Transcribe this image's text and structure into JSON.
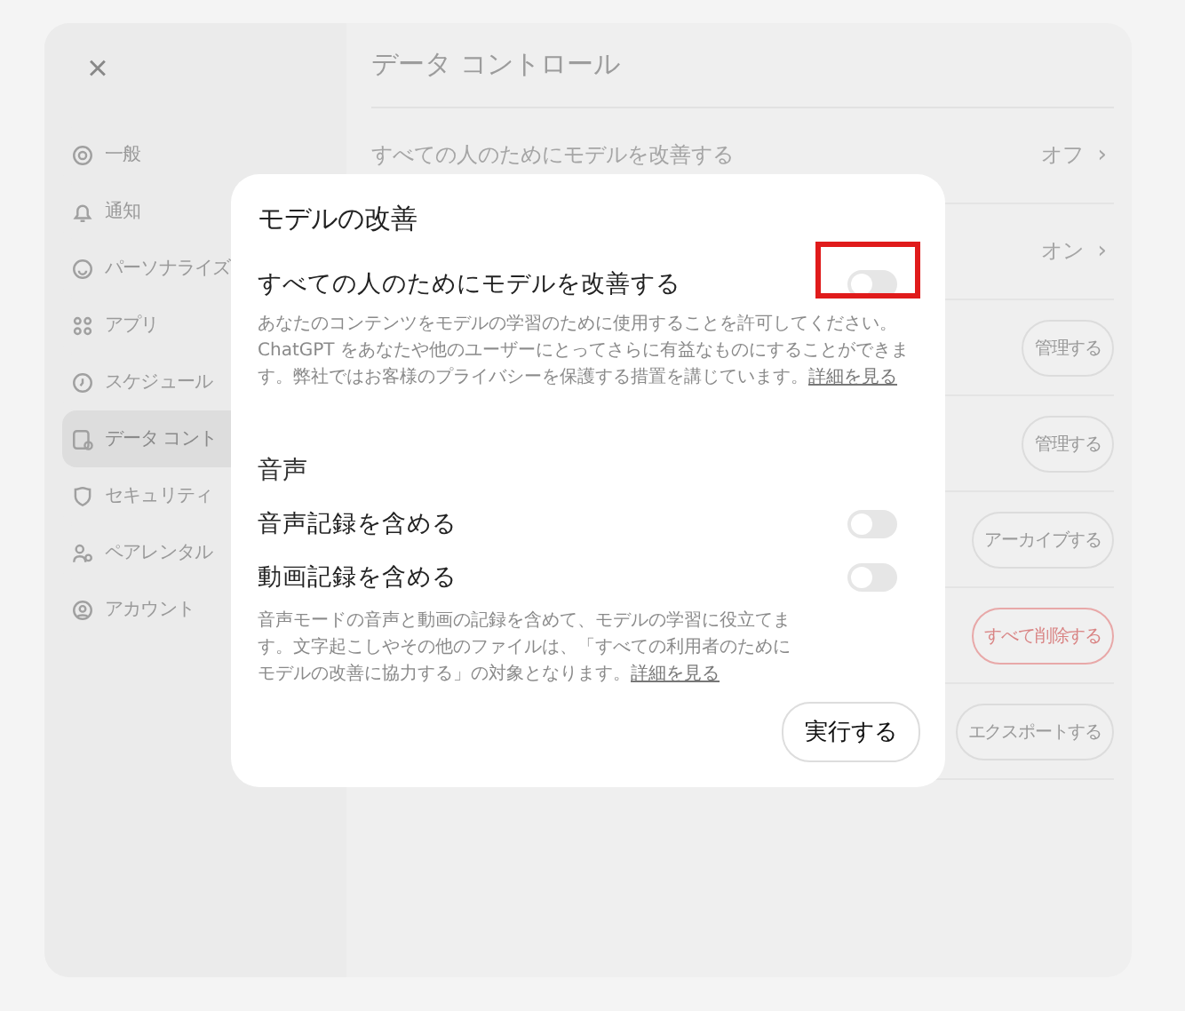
{
  "sidebar": {
    "close": "×",
    "items": [
      {
        "label": "一般",
        "selected": false
      },
      {
        "label": "通知",
        "selected": false
      },
      {
        "label": "パーソナライズ",
        "selected": false
      },
      {
        "label": "アプリ",
        "selected": false
      },
      {
        "label": "スケジュール",
        "selected": false
      },
      {
        "label": "データ コント",
        "selected": true
      },
      {
        "label": "セキュリティ",
        "selected": false
      },
      {
        "label": "ペアレンタル",
        "selected": false
      },
      {
        "label": "アカウント",
        "selected": false
      }
    ]
  },
  "panel": {
    "title": "データ コントロール",
    "rows": [
      {
        "kind": "value",
        "label": "すべての人のためにモデルを改善する",
        "value": "オフ",
        "chevron": "›"
      },
      {
        "kind": "value",
        "value": "オン",
        "chevron": "›"
      },
      {
        "kind": "button",
        "action": "管理する",
        "danger": false
      },
      {
        "kind": "button",
        "action": "管理する",
        "danger": false
      },
      {
        "kind": "button",
        "action": "アーカイブする",
        "danger": false
      },
      {
        "kind": "button",
        "action": "すべて削除する",
        "danger": true
      },
      {
        "kind": "button",
        "action": "エクスポートする",
        "danger": false
      }
    ]
  },
  "modal": {
    "title": "モデルの改善",
    "toggle": {
      "label": "すべての人のためにモデルを改善する",
      "on": false,
      "highlighted": true
    },
    "description": "あなたのコンテンツをモデルの学習のために使用することを許可してください。ChatGPT をあなたや他のユーザーにとってさらに有益なものにすることができます。弊社ではお客様のプライバシーを保護する措置を講じています。",
    "link": "詳細を見る",
    "voice": {
      "heading": "音声",
      "toggles": [
        {
          "label": "音声記録を含める",
          "on": false
        },
        {
          "label": "動画記録を含める",
          "on": false
        }
      ],
      "description": "音声モードの音声と動画の記録を含めて、モデルの学習に役立てます。文字起こしやその他のファイルは、「すべての利用者のためにモデルの改善に協力する」の対象となります。",
      "link": "詳細を見る"
    },
    "button": "実行する"
  }
}
